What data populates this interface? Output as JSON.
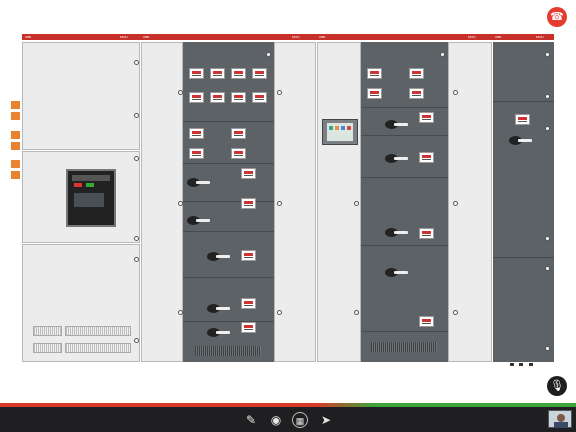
{
  "switchboard": {
    "brand_left": "ABB",
    "model_left": "MNS i",
    "brand_mid1": "ABB",
    "model_mid1": "MNS i",
    "brand_mid2": "ABB",
    "model_mid2": "MNS i",
    "brand_right": "ABB",
    "model_right": "MNS i"
  },
  "controls": {
    "end_call_icon": "phone-hangup-icon",
    "mute_icon": "microphone-off-icon",
    "pointer_icon": "pointer-icon",
    "camera_icon": "camera-icon",
    "gallery_icon": "image-icon",
    "send_icon": "send-icon"
  },
  "colors": {
    "end_call": "#e53b2e",
    "strip": "#c8302a",
    "toolbar": "#1f1f21"
  }
}
